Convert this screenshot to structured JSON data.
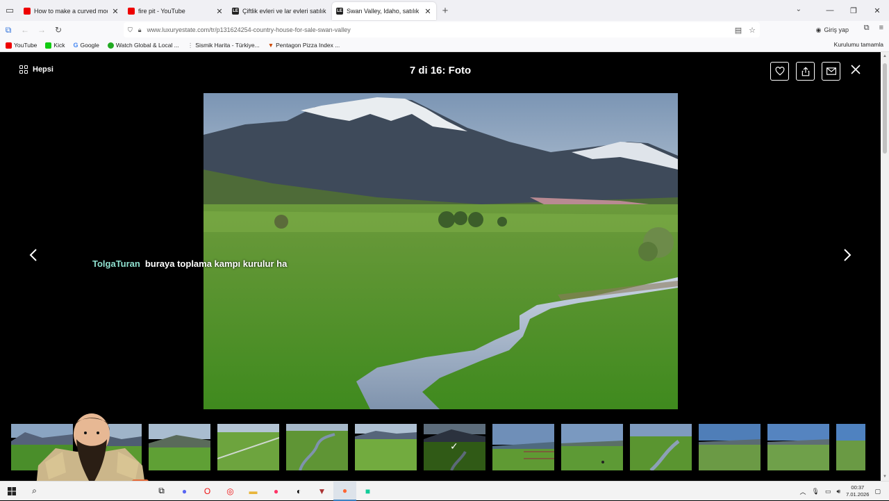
{
  "browser": {
    "tabs": [
      {
        "title": "How to make a curved modern",
        "favicon": "youtube",
        "active": false
      },
      {
        "title": "fire pit - YouTube",
        "favicon": "youtube",
        "active": false
      },
      {
        "title": "Çiftlik evleri ve lar evleri satılık",
        "favicon": "luxuryestate",
        "active": false
      },
      {
        "title": "Swan Valley, Idaho, satılık Lüks",
        "favicon": "luxuryestate",
        "active": true
      }
    ],
    "url": "www.luxuryestate.com/tr/p131624254-country-house-for-sale-swan-valley",
    "signin_label": "Giriş yap",
    "bookmarks": [
      "YouTube",
      "Kick",
      "Google",
      "Watch Global & Local ...",
      "Sismik Harita - Türkiye...",
      "Pentagon Pizza Index ..."
    ],
    "bookmark_right": "Kurulumu tamamla"
  },
  "gallery": {
    "all_label": "Hepsi",
    "counter": "7 di 16: Foto",
    "thumbnail_count": 13,
    "selected_thumbnail": 7
  },
  "overlay": {
    "chat_user": "TolgaTuran",
    "chat_text": "buraya toplama kampı kurulur ha"
  },
  "taskbar": {
    "time": "00:37",
    "date": "7.01.2026"
  }
}
